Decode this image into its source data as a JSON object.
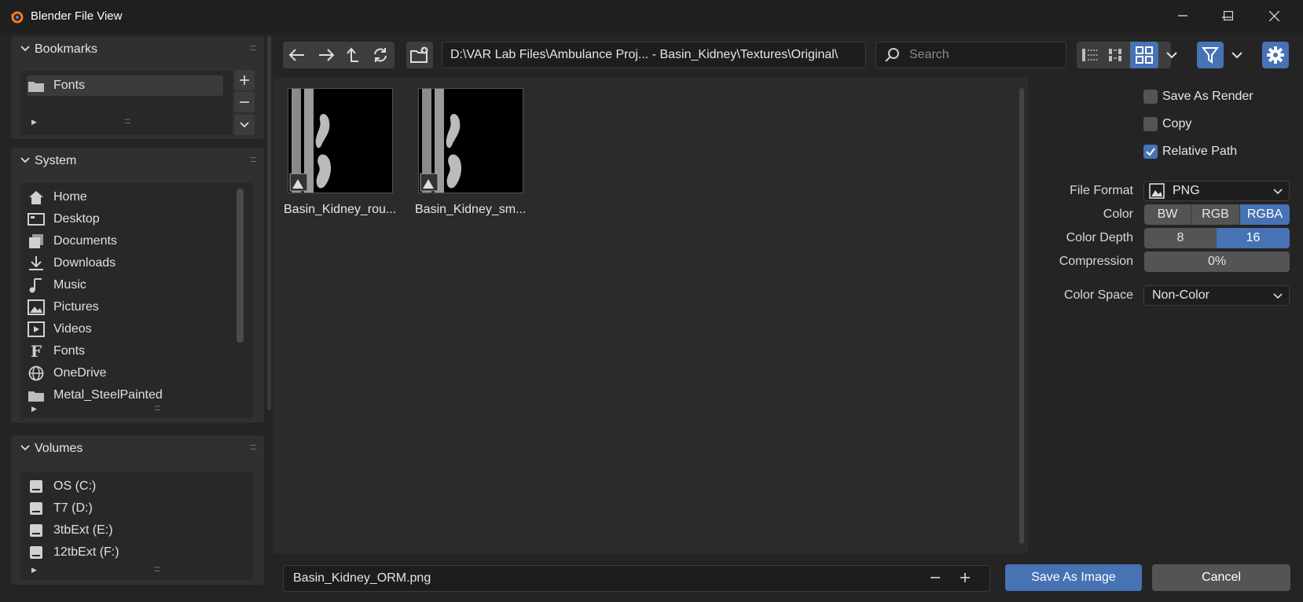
{
  "window": {
    "title": "Blender File View"
  },
  "sidebar": {
    "bookmarks": {
      "title": "Bookmarks",
      "items": [
        {
          "label": "Fonts",
          "icon": "folder-icon"
        }
      ]
    },
    "system": {
      "title": "System",
      "items": [
        {
          "label": "Home",
          "icon": "home-icon"
        },
        {
          "label": "Desktop",
          "icon": "desktop-icon"
        },
        {
          "label": "Documents",
          "icon": "documents-icon"
        },
        {
          "label": "Downloads",
          "icon": "download-icon"
        },
        {
          "label": "Music",
          "icon": "music-icon"
        },
        {
          "label": "Pictures",
          "icon": "picture-icon"
        },
        {
          "label": "Videos",
          "icon": "video-icon"
        },
        {
          "label": "Fonts",
          "icon": "font-icon"
        },
        {
          "label": "OneDrive",
          "icon": "globe-icon"
        },
        {
          "label": "Metal_SteelPainted",
          "icon": "folder-icon"
        }
      ]
    },
    "volumes": {
      "title": "Volumes",
      "items": [
        {
          "label": "OS (C:)",
          "icon": "drive-icon"
        },
        {
          "label": "T7 (D:)",
          "icon": "drive-icon"
        },
        {
          "label": "3tbExt (E:)",
          "icon": "drive-icon"
        },
        {
          "label": "12tbExt (F:)",
          "icon": "drive-icon"
        }
      ]
    }
  },
  "toolbar": {
    "path": "D:\\VAR Lab Files\\Ambulance Proj... - Basin_Kidney\\Textures\\Original\\",
    "search_placeholder": "Search"
  },
  "files": [
    {
      "name": "Basin_Kidney_rou...",
      "icon": "image-file-icon"
    },
    {
      "name": "Basin_Kidney_sm...",
      "icon": "image-file-icon"
    }
  ],
  "options": {
    "save_as_render": {
      "label": "Save As Render",
      "checked": false
    },
    "copy": {
      "label": "Copy",
      "checked": false
    },
    "relative_path": {
      "label": "Relative Path",
      "checked": true
    },
    "file_format": {
      "label": "File Format",
      "value": "PNG"
    },
    "color": {
      "label": "Color",
      "options": [
        "BW",
        "RGB",
        "RGBA"
      ],
      "selected": "RGBA"
    },
    "color_depth": {
      "label": "Color Depth",
      "options": [
        "8",
        "16"
      ],
      "selected": "16"
    },
    "compression": {
      "label": "Compression",
      "value": "0%"
    },
    "color_space": {
      "label": "Color Space",
      "value": "Non-Color"
    }
  },
  "footer": {
    "filename": "Basin_Kidney_ORM.png",
    "save_label": "Save As Image",
    "cancel_label": "Cancel"
  },
  "colors": {
    "accent": "#4772b3",
    "background": "#242424",
    "panel": "#303030"
  }
}
